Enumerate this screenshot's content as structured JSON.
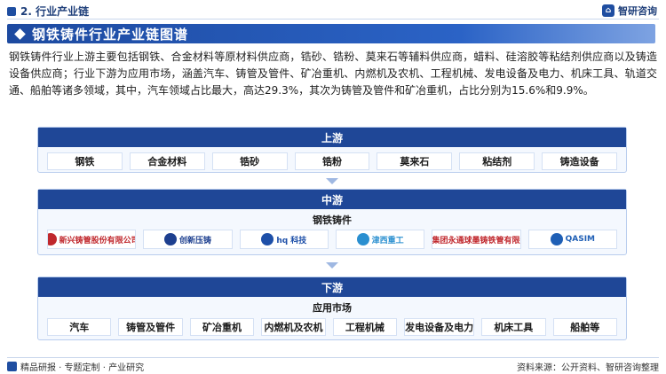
{
  "header": {
    "section_title": "2. 行业产业链",
    "brand_name": "智研咨询",
    "brand_icon": "zhiyan-logo-icon"
  },
  "banner": {
    "title": "钢铁铸件行业产业链图谱"
  },
  "description": "钢铁铸件行业上游主要包括钢铁、合金材料等原材料供应商，锆砂、锆粉、莫来石等辅料供应商，蜡料、硅溶胶等粘结剂供应商以及铸造设备供应商；行业下游为应用市场，涵盖汽车、铸管及管件、矿冶重机、内燃机及农机、工程机械、发电设备及电力、机床工具、轨道交通、船舶等诸多领域，其中，汽车领域占比最大，高达29.3%，其次为铸管及管件和矿冶重机，占比分别为15.6%和9.9%。",
  "upstream": {
    "title": "上游",
    "items": [
      "钢铁",
      "合金材料",
      "锆砂",
      "锆粉",
      "莫来石",
      "粘结剂",
      "铸造设备"
    ]
  },
  "midstream": {
    "title": "中游",
    "subtitle": "钢铁铸件",
    "logos": [
      {
        "text": "新兴铸管股份有限公司",
        "color": "#c0282d"
      },
      {
        "text": "创新压铸",
        "color": "#1d3f8f"
      },
      {
        "text": "hq 科技",
        "color": "#1d4fa8"
      },
      {
        "text": "津西重工",
        "color": "#2a8fd0"
      },
      {
        "text": "安钢集团永通球墨铸铁管有限责任公司",
        "color": "#c0282d"
      },
      {
        "text": "QASIM",
        "color": "#1f5fb5"
      }
    ]
  },
  "downstream": {
    "title": "下游",
    "subtitle": "应用市场",
    "items": [
      "汽车",
      "铸管及管件",
      "矿冶重机",
      "内燃机及农机",
      "工程机械",
      "发电设备及电力",
      "机床工具",
      "船舶等"
    ]
  },
  "footer": {
    "left": "精品研报 · 专题定制 · 产业研究",
    "right": "资料来源：公开资料、智研咨询整理"
  }
}
